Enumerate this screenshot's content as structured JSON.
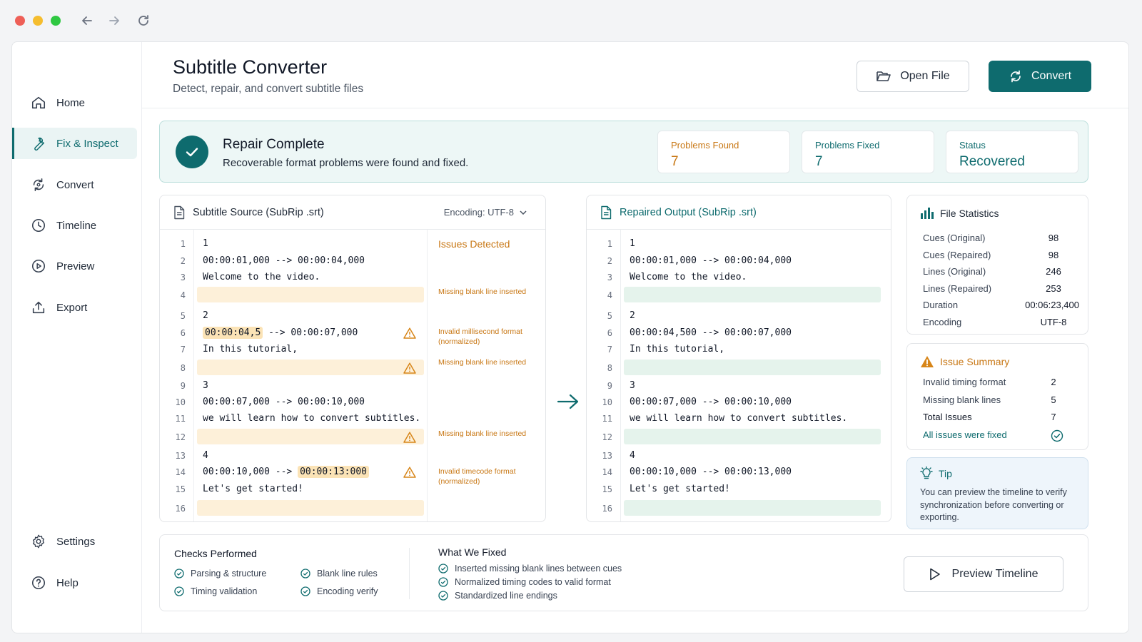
{
  "app": {
    "title": "Subtitle Converter",
    "subtitle": "Detect, repair, and convert subtitle files"
  },
  "toolbar": {
    "open_label": "Open File",
    "convert_label": "Convert"
  },
  "sidebar": {
    "items": [
      {
        "label": "Home",
        "icon": "home-icon"
      },
      {
        "label": "Fix & Inspect",
        "icon": "wrench-icon"
      },
      {
        "label": "Convert",
        "icon": "convert-icon"
      },
      {
        "label": "Timeline",
        "icon": "clock-icon"
      },
      {
        "label": "Preview",
        "icon": "play-circle-icon"
      },
      {
        "label": "Export",
        "icon": "upload-icon"
      }
    ],
    "bottom": [
      {
        "label": "Settings",
        "icon": "gear-icon"
      },
      {
        "label": "Help",
        "icon": "help-icon"
      }
    ]
  },
  "banner": {
    "title": "Repair Complete",
    "message": "Recoverable format problems were found and fixed.",
    "stats": [
      {
        "label": "Problems Found",
        "value": "7"
      },
      {
        "label": "Problems Fixed",
        "value": "7"
      },
      {
        "label": "Status",
        "value": "Recovered"
      }
    ]
  },
  "source": {
    "title": "Subtitle Source (SubRip .srt)",
    "encoding": "Encoding: UTF-8",
    "issues_title": "Issues Detected",
    "lines": [
      {
        "n": "1",
        "text": "1"
      },
      {
        "n": "2",
        "text": "00:00:01,000 --> 00:00:04,000"
      },
      {
        "n": "3",
        "text": "Welcome to the video."
      },
      {
        "n": "4",
        "text": ""
      },
      {
        "n": "5",
        "text": "2"
      },
      {
        "n": "6",
        "hl": "00:00:04,5",
        "text": " --> 00:00:07,000"
      },
      {
        "n": "7",
        "text": "In this tutorial,"
      },
      {
        "n": "8",
        "text": ""
      },
      {
        "n": "9",
        "text": "3"
      },
      {
        "n": "10",
        "text": "00:00:07,000 --> 00:00:10,000"
      },
      {
        "n": "11",
        "text": "we will learn how to convert subtitles."
      },
      {
        "n": "12",
        "text": ""
      },
      {
        "n": "13",
        "text": "4"
      },
      {
        "n": "14",
        "pre": "00:00:10,000 --> ",
        "hl": "00:00:13:000"
      },
      {
        "n": "15",
        "text": "Let's get started!"
      },
      {
        "n": "16",
        "text": ""
      }
    ],
    "issues": [
      "Missing blank line inserted",
      "Invalid millisecond format (normalized)",
      "Missing blank line inserted",
      "Missing blank line inserted",
      "Invalid timecode format (normalized)"
    ]
  },
  "output": {
    "title": "Repaired Output (SubRip .srt)",
    "lines": [
      {
        "n": "1",
        "text": "1"
      },
      {
        "n": "2",
        "text": "00:00:01,000 --> 00:00:04,000"
      },
      {
        "n": "3",
        "text": "Welcome to the video."
      },
      {
        "n": "4",
        "text": ""
      },
      {
        "n": "5",
        "text": "2"
      },
      {
        "n": "6",
        "text": "00:00:04,500 --> 00:00:07,000"
      },
      {
        "n": "7",
        "text": "In this tutorial,"
      },
      {
        "n": "8",
        "text": ""
      },
      {
        "n": "9",
        "text": "3"
      },
      {
        "n": "10",
        "text": "00:00:07,000 --> 00:00:10,000"
      },
      {
        "n": "11",
        "text": "we will learn how to convert subtitles."
      },
      {
        "n": "12",
        "text": ""
      },
      {
        "n": "13",
        "text": "4"
      },
      {
        "n": "14",
        "text": "00:00:10,000 --> 00:00:13,000"
      },
      {
        "n": "15",
        "text": "Let's get started!"
      },
      {
        "n": "16",
        "text": ""
      }
    ]
  },
  "file_stats": {
    "title": "File Statistics",
    "rows": [
      {
        "label": "Cues (Original)",
        "value": "98"
      },
      {
        "label": "Cues (Repaired)",
        "value": "98"
      },
      {
        "label": "Lines (Original)",
        "value": "246"
      },
      {
        "label": "Lines (Repaired)",
        "value": "253"
      },
      {
        "label": "Duration",
        "value": "00:06:23,400"
      },
      {
        "label": "Encoding",
        "value": "UTF-8"
      }
    ]
  },
  "issue_summary": {
    "title": "Issue Summary",
    "rows": [
      {
        "label": "Invalid timing format",
        "value": "2"
      },
      {
        "label": "Missing blank lines",
        "value": "5"
      },
      {
        "label": "Total Issues",
        "value": "7"
      }
    ],
    "fixed_note": "All issues were fixed"
  },
  "tip": {
    "title": "Tip",
    "text": "You can preview the timeline to verify synchronization before converting or exporting."
  },
  "checks": {
    "title": "Checks Performed",
    "items": [
      "Parsing & structure",
      "Blank line rules",
      "Timing validation",
      "Encoding verify"
    ]
  },
  "fixed": {
    "title": "What We Fixed",
    "items": [
      "Inserted missing blank lines between cues",
      "Normalized timing codes to valid format",
      "Standardized line endings"
    ]
  },
  "preview_button": "Preview Timeline",
  "colors": {
    "accent": "#0e6b6e",
    "warning": "#c87714",
    "success_bg": "#edf7f6"
  }
}
